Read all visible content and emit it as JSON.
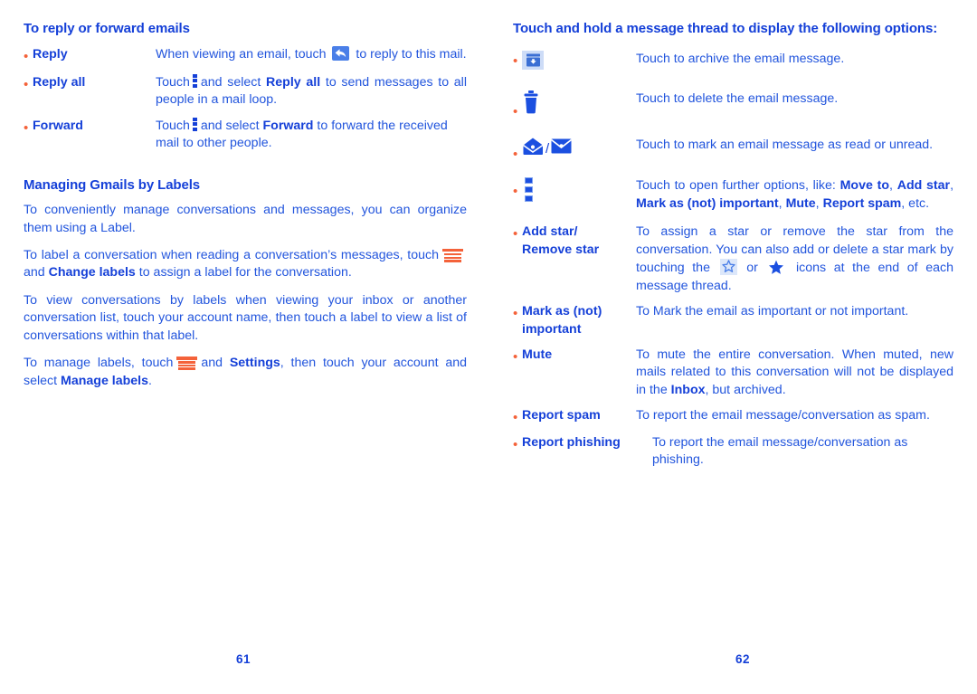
{
  "colors": {
    "heading_blue": "#1540d8",
    "body_blue": "#2255dd",
    "bullet_orange": "#f4623a",
    "icon_orange": "#f4623a",
    "icon_blue": "#1b4fe0",
    "icon_tile_blue": "#cddcf7"
  },
  "left_page": {
    "page_number": "61",
    "section1": {
      "title": "To reply or forward emails",
      "items": [
        {
          "term": "Reply",
          "desc_before": "When viewing an email, touch",
          "icon": "reply-icon",
          "desc_after": "to reply to this mail."
        },
        {
          "term": "Reply all",
          "desc_before": "Touch",
          "icon": "overflow-dots-icon",
          "desc_mid": "and select",
          "bold": "Reply all",
          "desc_after": "to send messages to all people in a mail loop."
        },
        {
          "term": "Forward",
          "desc_before": "Touch",
          "icon": "overflow-dots-icon",
          "desc_mid": "and select",
          "bold": "Forward",
          "desc_after": "to forward the received mail to other people."
        }
      ]
    },
    "section2": {
      "title": "Managing Gmails by Labels",
      "para1": "To conveniently manage conversations and messages, you can organize them using a Label.",
      "para2_a": "To label a conversation when reading a conversation’s messages, touch",
      "para2_icon": "labels-icon",
      "para2_b": "and",
      "para2_bold": "Change labels",
      "para2_c": "to assign a label for the conversation.",
      "para3": "To view conversations by labels when viewing your inbox or another conversation list, touch your account name, then touch a label to view a list of conversations within that label.",
      "para4_a": "To manage labels, touch",
      "para4_icon": "labels-icon",
      "para4_b": "and",
      "para4_bold1": "Settings",
      "para4_c": ", then touch your account and select",
      "para4_bold2": "Manage labels",
      "para4_d": "."
    }
  },
  "right_page": {
    "page_number": "62",
    "intro": "Touch and hold a message thread to display the following options:",
    "items": [
      {
        "icon": "archive-icon",
        "term": "",
        "desc": "Touch to archive the email message."
      },
      {
        "icon": "trash-icon",
        "term": "",
        "desc": "Touch to delete the email message."
      },
      {
        "icon": "envelope-open-closed-icon",
        "term": "",
        "desc": "Touch to mark an email message as read or unread."
      },
      {
        "icon": "overflow-dots-icon",
        "term": "",
        "desc_a": "Touch to open further options, like:",
        "bold1": "Move to",
        "sep1": ",",
        "bold2": "Add star",
        "sep2": ",",
        "bold3": "Mark as (not) important",
        "sep3": ",",
        "bold4": "Mute",
        "sep4": ",",
        "bold5": "Report spam",
        "desc_b": ", etc."
      },
      {
        "term_line1": "Add star/",
        "term_line2": "Remove star",
        "desc_a": "To assign a star or remove the star from the conversation. You can also add or delete a star mark by touching the",
        "icon1": "star-outline-icon",
        "desc_b": "or",
        "icon2": "star-filled-icon",
        "desc_c": "icons at the end of each message thread."
      },
      {
        "term_line1": "Mark as (not)",
        "term_line2": "important",
        "desc": "To Mark the email as important or not important."
      },
      {
        "term": "Mute",
        "desc_a": "To mute the entire conversation. When muted, new mails related to this conversation will not be displayed in the",
        "bold": "Inbox",
        "desc_b": ", but archived."
      },
      {
        "term": "Report spam",
        "desc": "To report the email message/conversation as spam."
      },
      {
        "term": "Report phishing",
        "desc": "To report the email message/conversation as phishing."
      }
    ]
  }
}
